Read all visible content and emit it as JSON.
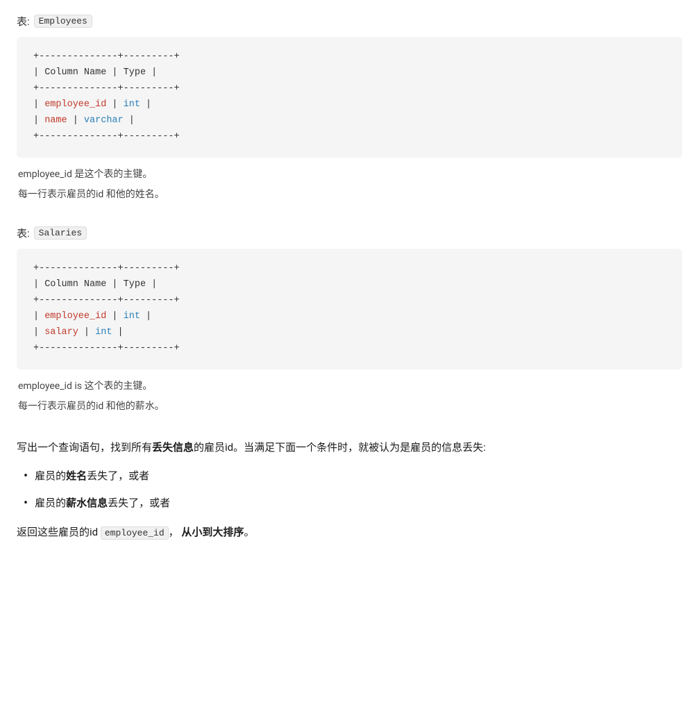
{
  "table1": {
    "label_prefix": "表:",
    "table_name": "Employees",
    "divider_top": "+--------------+---------+",
    "divider_mid": "+--------------+---------+",
    "divider_bot": "+--------------+---------+",
    "header_col1": "Column Name",
    "header_col2": "Type",
    "row1_name": "employee_id",
    "row1_type": "int",
    "row2_name": "name",
    "row2_type": "varchar",
    "desc1": "employee_id 是这个表的主键。",
    "desc2": "每一行表示雇员的id 和他的姓名。"
  },
  "table2": {
    "label_prefix": "表:",
    "table_name": "Salaries",
    "divider_top": "+--------------+---------+",
    "divider_mid": "+--------------+---------+",
    "divider_bot": "+--------------+---------+",
    "header_col1": "Column Name",
    "header_col2": "Type",
    "row1_name": "employee_id",
    "row1_type": "int",
    "row2_name": "salary",
    "row2_type": "int",
    "desc1": "employee_id is 这个表的主键。",
    "desc2": "每一行表示雇员的id 和他的薪水。"
  },
  "question": {
    "intro": "写出一个查询语句，找到所有",
    "bold1": "丢失信息",
    "intro2": "的雇员id。当满足下面一个条件时，就被认为是雇员的信息丢失:",
    "bullet1_prefix": "雇员的",
    "bullet1_bold": "姓名",
    "bullet1_suffix": "丢失了，或者",
    "bullet2_prefix": "雇员的",
    "bullet2_bold": "薪水信息",
    "bullet2_suffix": "丢失了，或者",
    "return_prefix": "返回这些雇员的id",
    "return_code": "employee_id",
    "return_suffix": "，",
    "return_bold": "从小到大排序",
    "return_end": "。"
  }
}
